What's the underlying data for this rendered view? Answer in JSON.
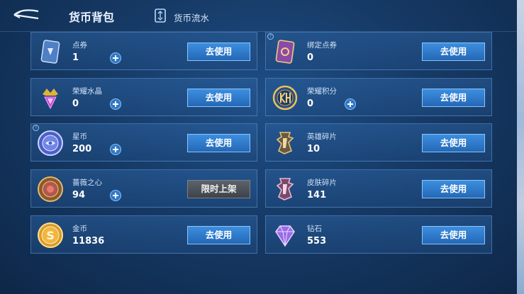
{
  "header": {
    "title": "货币背包",
    "flow_label": "货币流水"
  },
  "colors": {
    "accent_button": "#2f7fd3",
    "disabled_button": "#4b5058",
    "card_bg": "#25578f"
  },
  "currencies": [
    {
      "name": "点券",
      "amount": "1",
      "icon": "coupon-card-icon",
      "has_plus": true,
      "button": "去使用"
    },
    {
      "name": "绑定点券",
      "amount": "0",
      "icon": "bound-coupon-card-icon",
      "has_plus": false,
      "button": "去使用"
    },
    {
      "name": "荣耀水晶",
      "amount": "0",
      "icon": "glory-crystal-icon",
      "has_plus": true,
      "button": "去使用"
    },
    {
      "name": "荣耀积分",
      "amount": "0",
      "icon": "glory-points-icon",
      "has_plus": true,
      "button": "去使用"
    },
    {
      "name": "星币",
      "amount": "200",
      "icon": "star-coin-icon",
      "has_plus": true,
      "button": "去使用"
    },
    {
      "name": "英雄碎片",
      "amount": "10",
      "icon": "hero-fragment-icon",
      "has_plus": false,
      "button": "去使用"
    },
    {
      "name": "蔷薇之心",
      "amount": "94",
      "icon": "rose-heart-icon",
      "has_plus": true,
      "button": "限时上架"
    },
    {
      "name": "皮肤碎片",
      "amount": "141",
      "icon": "skin-fragment-icon",
      "has_plus": false,
      "button": "去使用"
    },
    {
      "name": "金币",
      "amount": "11836",
      "icon": "gold-coin-icon",
      "has_plus": false,
      "button": "去使用"
    },
    {
      "name": "钻石",
      "amount": "553",
      "icon": "diamond-icon",
      "has_plus": false,
      "button": "去使用"
    }
  ]
}
